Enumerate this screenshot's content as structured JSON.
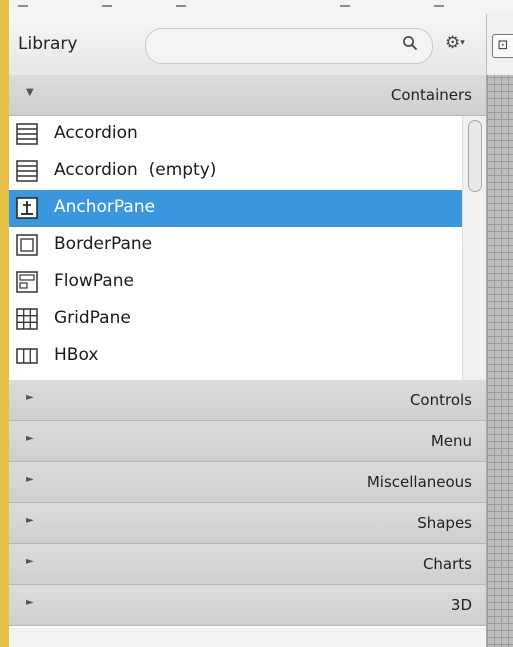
{
  "library": {
    "title": "Library",
    "search_icon": "search-icon",
    "gear_icon": "gear-icon",
    "gear_caret": "▾"
  },
  "containers_section": {
    "title": "Containers",
    "expanded": true,
    "items": [
      {
        "label": "Accordion",
        "icon": "accordion-icon",
        "selected": false
      },
      {
        "label": "Accordion  (empty)",
        "icon": "accordion-icon",
        "selected": false
      },
      {
        "label": "AnchorPane",
        "icon": "anchorpane-icon",
        "selected": true
      },
      {
        "label": "BorderPane",
        "icon": "borderpane-icon",
        "selected": false
      },
      {
        "label": "FlowPane",
        "icon": "flowpane-icon",
        "selected": false
      },
      {
        "label": "GridPane",
        "icon": "gridpane-icon",
        "selected": false
      },
      {
        "label": "HBox",
        "icon": "hbox-icon",
        "selected": false
      }
    ]
  },
  "collapsed_sections": [
    {
      "title": "Controls"
    },
    {
      "title": "Menu"
    },
    {
      "title": "Miscellaneous"
    },
    {
      "title": "Shapes"
    },
    {
      "title": "Charts"
    },
    {
      "title": "3D"
    }
  ],
  "colors": {
    "selection": "#3a96dd",
    "accent": "#e7c04a"
  },
  "right_toolbar_glyph": "⊡"
}
